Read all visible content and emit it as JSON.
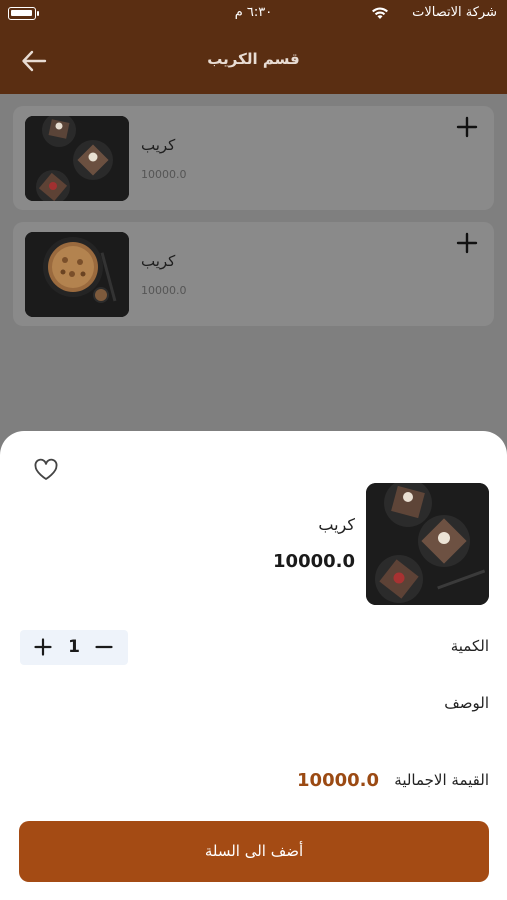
{
  "status_bar": {
    "carrier": "شركة الاتصالات",
    "time": "٦:٣٠ م"
  },
  "header": {
    "title": "قسم الكريب"
  },
  "items": [
    {
      "name": "كريب",
      "price": "10000.0"
    },
    {
      "name": "كريب",
      "price": "10000.0"
    }
  ],
  "sheet": {
    "product_name": "كريب",
    "product_price": "10000.0",
    "quantity_label": "الكمية",
    "quantity_value": "1",
    "description_label": "الوصف",
    "total_label": "القيمة الاجمالية",
    "total_value": "10000.0",
    "add_to_cart_label": "أضف الى السلة"
  },
  "icons": {
    "back": "arrow-left-icon",
    "add": "plus-icon",
    "favorite": "heart-outline-icon",
    "wifi": "wifi-icon",
    "battery": "battery-icon"
  },
  "colors": {
    "header_brown": "#5a2e12",
    "accent_brown": "#a44b14",
    "total_brown": "#9b4a13",
    "stepper_bg": "#eef3fa"
  }
}
